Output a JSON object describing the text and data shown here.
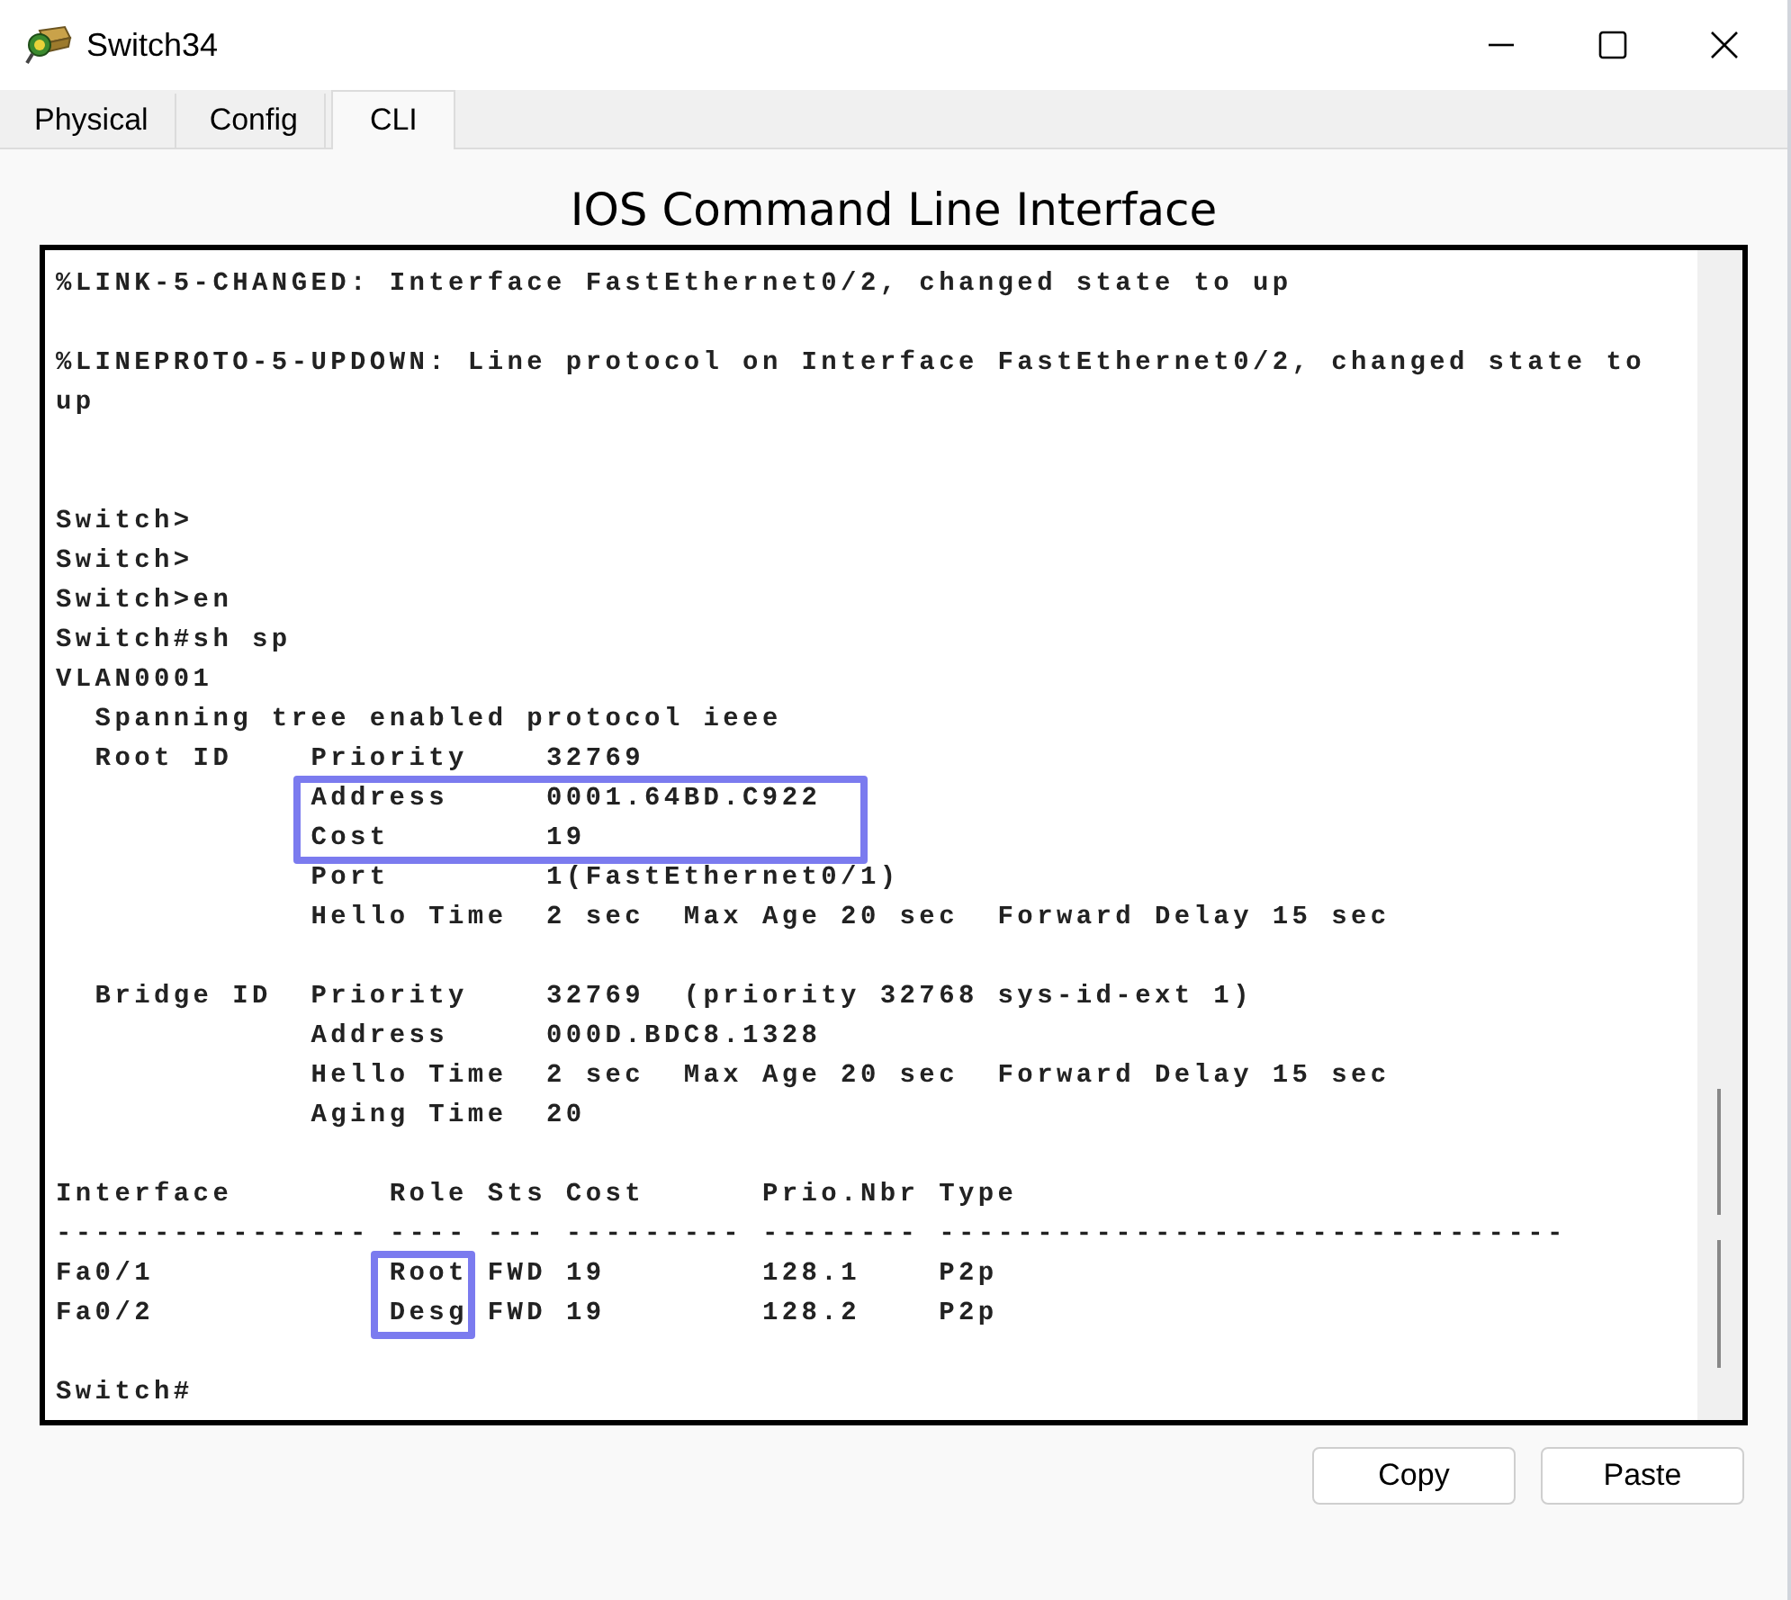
{
  "window": {
    "title": "Switch34"
  },
  "tabs": [
    {
      "label": "Physical",
      "selected": false
    },
    {
      "label": "Config",
      "selected": false
    },
    {
      "label": "CLI",
      "selected": true
    }
  ],
  "heading": "IOS Command Line Interface",
  "terminal": {
    "lines": [
      {
        "kind": "text",
        "segments": [
          {
            "text": "%LINK-5-CHANGED: Interface FastEthernet0/2, changed state to up",
            "boxed": false
          }
        ]
      },
      {
        "kind": "blank"
      },
      {
        "kind": "text",
        "segments": [
          {
            "text": "%LINEPROTO-5-UPDOWN: Line protocol on Interface FastEthernet0/2, changed state to",
            "boxed": false
          }
        ]
      },
      {
        "kind": "text",
        "segments": [
          {
            "text": "up",
            "boxed": false
          }
        ]
      },
      {
        "kind": "blank"
      },
      {
        "kind": "blank"
      },
      {
        "kind": "text",
        "segments": [
          {
            "text": "Switch>",
            "boxed": false
          }
        ]
      },
      {
        "kind": "text",
        "segments": [
          {
            "text": "Switch>",
            "boxed": false
          }
        ]
      },
      {
        "kind": "text",
        "segments": [
          {
            "text": "Switch>en",
            "boxed": false
          }
        ]
      },
      {
        "kind": "text",
        "segments": [
          {
            "text": "Switch#sh sp",
            "boxed": false
          }
        ]
      },
      {
        "kind": "text",
        "segments": [
          {
            "text": "VLAN0001",
            "boxed": false
          }
        ]
      },
      {
        "kind": "text",
        "segments": [
          {
            "text": "  Spanning tree enabled protocol ieee",
            "boxed": false
          }
        ]
      },
      {
        "kind": "text",
        "segments": [
          {
            "text": "  Root ID    Priority    32769",
            "boxed": false
          }
        ]
      },
      {
        "kind": "field_row",
        "segments": [
          {
            "text": "Address     0001.64BD.C922",
            "boxed": true
          }
        ]
      },
      {
        "kind": "field_row",
        "segments": [
          {
            "text": "Cost        19",
            "boxed": true
          }
        ]
      },
      {
        "kind": "text",
        "segments": [
          {
            "text": "             Port        1(FastEthernet0/1)",
            "boxed": false
          }
        ]
      },
      {
        "kind": "text",
        "segments": [
          {
            "text": "             Hello Time  2 sec  Max Age 20 sec  Forward Delay 15 sec",
            "boxed": false
          }
        ]
      },
      {
        "kind": "blank"
      },
      {
        "kind": "text",
        "segments": [
          {
            "text": "  Bridge ID  Priority    32769  (priority 32768 sys-id-ext 1)",
            "boxed": false
          }
        ]
      },
      {
        "kind": "text",
        "segments": [
          {
            "text": "             Address     000D.BDC8.1328",
            "boxed": false
          }
        ]
      },
      {
        "kind": "text",
        "segments": [
          {
            "text": "             Hello Time  2 sec  Max Age 20 sec  Forward Delay 15 sec",
            "boxed": false
          }
        ]
      },
      {
        "kind": "text",
        "segments": [
          {
            "text": "             Aging Time  20",
            "boxed": false
          }
        ]
      },
      {
        "kind": "blank"
      },
      {
        "kind": "text",
        "segments": [
          {
            "text": "Interface        Role Sts Cost      Prio.Nbr Type",
            "boxed": false
          }
        ]
      },
      {
        "kind": "text",
        "segments": [
          {
            "text": "---------------- ---- --- --------- -------- --------------------------------",
            "boxed": false
          }
        ]
      },
      {
        "kind": "text",
        "segments": [
          {
            "text": "Fa0/1            ",
            "boxed": false
          },
          {
            "text": "Root",
            "boxed": true
          },
          {
            "text": " FWD 19        128.1    P2p",
            "boxed": false
          }
        ]
      },
      {
        "kind": "text",
        "segments": [
          {
            "text": "Fa0/2            ",
            "boxed": false
          },
          {
            "text": "Desg",
            "boxed": true
          },
          {
            "text": " FWD 19        128.2    P2p",
            "boxed": false
          }
        ]
      },
      {
        "kind": "blank"
      },
      {
        "kind": "text",
        "segments": [
          {
            "text": "Switch#",
            "boxed": false
          }
        ]
      }
    ]
  },
  "buttons": [
    "Copy",
    "Paste"
  ]
}
